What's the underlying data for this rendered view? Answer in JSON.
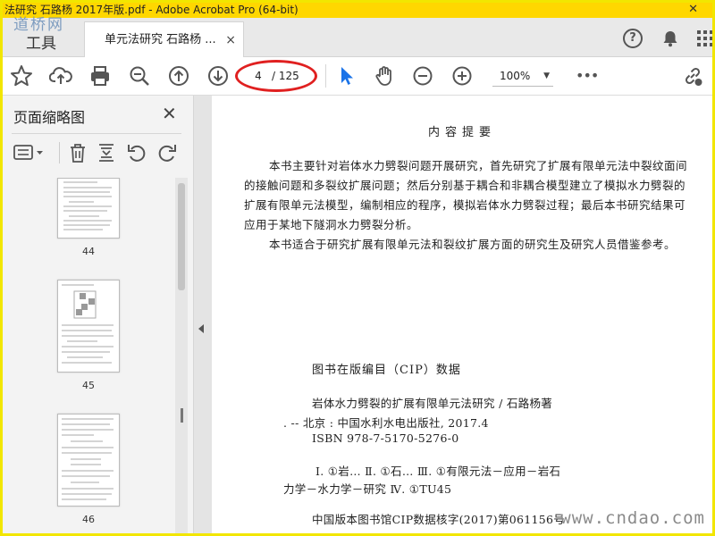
{
  "window": {
    "title": "法研究 石路杨 2017年版.pdf - Adobe Acrobat Pro (64-bit)",
    "close_glyph": "✕"
  },
  "watermarks": {
    "top": "道桥网",
    "bottom": "www.cndao.com"
  },
  "tabs": {
    "tools_label": "工具",
    "doc_label": "单元法研究 石路杨 ...",
    "doc_close": "×"
  },
  "header_icons": [
    "help-icon",
    "bell-icon",
    "apps-grid-icon"
  ],
  "toolbar": {
    "icons": [
      "bookmark-star-icon",
      "upload-cloud-icon",
      "print-icon",
      "zoom-out-magnifier-icon",
      "page-up-icon",
      "page-down-icon",
      "select-cursor-icon",
      "hand-tool-icon",
      "zoom-out-icon",
      "zoom-in-icon",
      "more-icon",
      "link-share-icon"
    ],
    "current_page": "4",
    "total_pages": "/ 125",
    "zoom": "100%",
    "more_label": "•••",
    "accent": "#1a73e8",
    "highlight_color": "#e02020"
  },
  "sidebar": {
    "title": "页面缩略图",
    "close_glyph": "✕",
    "tool_icons": [
      "thumbnail-options-icon",
      "delete-page-icon",
      "extract-page-icon",
      "rotate-left-icon",
      "rotate-right-icon"
    ],
    "thumbnails": [
      {
        "label": "44"
      },
      {
        "label": "45"
      },
      {
        "label": "46"
      }
    ]
  },
  "document": {
    "heading": "内容提要",
    "para1": "本书主要针对岩体水力劈裂问题开展研究，首先研究了扩展有限单元法中裂纹面间的接触问题和多裂纹扩展问题；然后分别基于耦合和非耦合模型建立了模拟水力劈裂的扩展有限单元法模型，编制相应的程序，模拟岩体水力劈裂过程；最后本书研究结果可应用于某地下隧洞水力劈裂分析。",
    "para2": "本书适合于研究扩展有限单元法和裂纹扩展方面的研究生及研究人员借鉴参考。",
    "cip_title": "图书在版编目（CIP）数据",
    "cip_line1": "岩体水力劈裂的扩展有限单元法研究 / 石路杨著",
    "cip_line2": ". -- 北京 : 中国水利水电出版社, 2017.4",
    "cip_line3": "ISBN 978-7-5170-5276-0",
    "cip_line4": "Ⅰ. ①岩… Ⅱ. ①石… Ⅲ. ①有限元法－应用－岩石",
    "cip_line5": "力学－水力学－研究 Ⅳ. ①TU45",
    "cip_line6": "中国版本图书馆CIP数据核字(2017)第061156号"
  }
}
